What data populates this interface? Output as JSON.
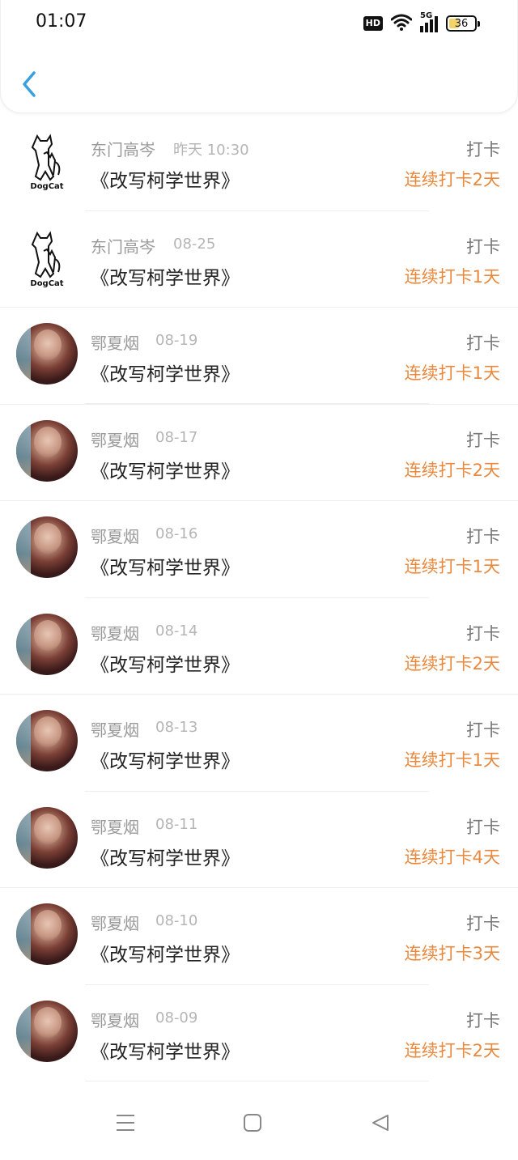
{
  "status_bar": {
    "time": "01:07",
    "hd": "HD",
    "network": "5G",
    "battery": "36"
  },
  "colors": {
    "accent_back": "#3a9fe0",
    "streak": "#e8893e"
  },
  "rows": [
    {
      "avatar": "dogcat",
      "name": "东门高岑",
      "date": "昨天 10:30",
      "title": "《改写柯学世界》",
      "action": "打卡",
      "streak": "连续打卡2天"
    },
    {
      "avatar": "dogcat",
      "name": "东门高岑",
      "date": "08-25",
      "title": "《改写柯学世界》",
      "action": "打卡",
      "streak": "连续打卡1天"
    },
    {
      "avatar": "person",
      "name": "鄂夏烟",
      "date": "08-19",
      "title": "《改写柯学世界》",
      "action": "打卡",
      "streak": "连续打卡1天"
    },
    {
      "avatar": "person",
      "name": "鄂夏烟",
      "date": "08-17",
      "title": "《改写柯学世界》",
      "action": "打卡",
      "streak": "连续打卡2天"
    },
    {
      "avatar": "person",
      "name": "鄂夏烟",
      "date": "08-16",
      "title": "《改写柯学世界》",
      "action": "打卡",
      "streak": "连续打卡1天"
    },
    {
      "avatar": "person",
      "name": "鄂夏烟",
      "date": "08-14",
      "title": "《改写柯学世界》",
      "action": "打卡",
      "streak": "连续打卡2天"
    },
    {
      "avatar": "person",
      "name": "鄂夏烟",
      "date": "08-13",
      "title": "《改写柯学世界》",
      "action": "打卡",
      "streak": "连续打卡1天"
    },
    {
      "avatar": "person",
      "name": "鄂夏烟",
      "date": "08-11",
      "title": "《改写柯学世界》",
      "action": "打卡",
      "streak": "连续打卡4天"
    },
    {
      "avatar": "person",
      "name": "鄂夏烟",
      "date": "08-10",
      "title": "《改写柯学世界》",
      "action": "打卡",
      "streak": "连续打卡3天"
    },
    {
      "avatar": "person",
      "name": "鄂夏烟",
      "date": "08-09",
      "title": "《改写柯学世界》",
      "action": "打卡",
      "streak": "连续打卡2天"
    }
  ],
  "dogcat_logo_text": "DogCat",
  "icons": {
    "back": "chevron-left-icon",
    "menu": "menu-icon",
    "home": "home-icon",
    "nav_back": "triangle-back-icon"
  }
}
